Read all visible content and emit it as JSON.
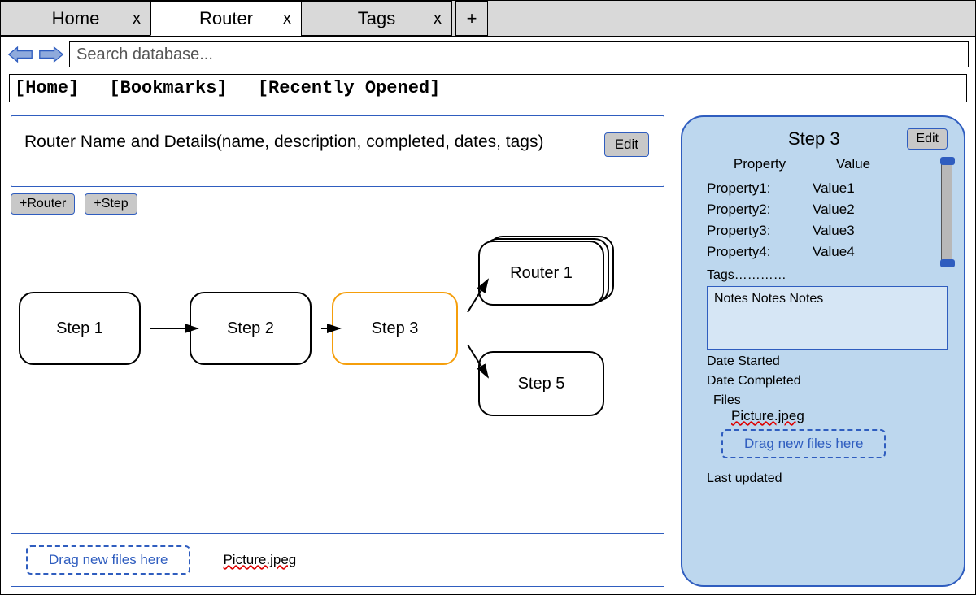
{
  "tabs": [
    {
      "label": "Home",
      "close": "x"
    },
    {
      "label": "Router",
      "close": "x"
    },
    {
      "label": "Tags",
      "close": "x"
    }
  ],
  "newtab_label": "+",
  "search": {
    "placeholder": "Search database..."
  },
  "navlinks": {
    "home": "[Home]",
    "bookmarks": "[Bookmarks]",
    "recent": "[Recently Opened]"
  },
  "details": {
    "text": "Router Name and Details(name, description, completed, dates, tags)",
    "edit_label": "Edit"
  },
  "buttons": {
    "add_router": "+Router",
    "add_step": "+Step"
  },
  "flow": {
    "step1": "Step 1",
    "step2": "Step 2",
    "step3": "Step 3",
    "router1": "Router 1",
    "step5": "Step 5"
  },
  "filestrip": {
    "drop_label": "Drag new files here",
    "file1": "Picture.jpeg"
  },
  "panel": {
    "title": "Step 3",
    "edit_label": "Edit",
    "header_key": "Property",
    "header_val": "Value",
    "rows": [
      {
        "k": "Property1:",
        "v": "Value1"
      },
      {
        "k": "Property2:",
        "v": "Value2"
      },
      {
        "k": "Property3:",
        "v": "Value3"
      },
      {
        "k": "Property4:",
        "v": "Value4"
      }
    ],
    "tags_label": "Tags…………",
    "notes": "Notes Notes Notes",
    "date_started": "Date Started",
    "date_completed": "Date Completed",
    "files_label": "Files",
    "file1": "Picture.jpeg",
    "drop_label": "Drag new files here",
    "last_updated": "Last updated"
  }
}
